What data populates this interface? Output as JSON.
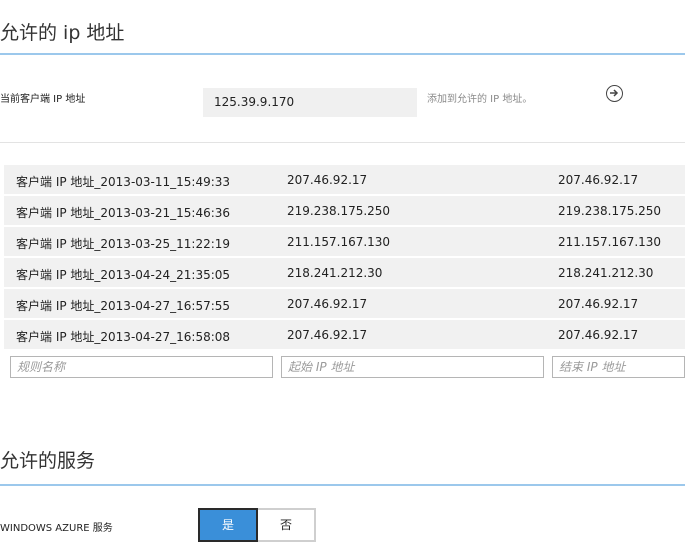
{
  "allowed_ip": {
    "title": "允许的 ip 地址",
    "current_client_label": "当前客户端 IP 地址",
    "current_client_value": "125.39.9.170",
    "add_hint": "添加到允许的 IP 地址。",
    "add_icon": "arrow-right-circle-icon"
  },
  "rules": [
    {
      "name": "客户端 IP 地址_2013-03-11_15:49:33",
      "start": "207.46.92.17",
      "end": "207.46.92.17"
    },
    {
      "name": "客户端 IP 地址_2013-03-21_15:46:36",
      "start": "219.238.175.250",
      "end": "219.238.175.250"
    },
    {
      "name": "客户端 IP 地址_2013-03-25_11:22:19",
      "start": "211.157.167.130",
      "end": "211.157.167.130"
    },
    {
      "name": "客户端 IP 地址_2013-04-24_21:35:05",
      "start": "218.241.212.30",
      "end": "218.241.212.30"
    },
    {
      "name": "客户端 IP 地址_2013-04-27_16:57:55",
      "start": "207.46.92.17",
      "end": "207.46.92.17"
    },
    {
      "name": "客户端 IP 地址_2013-04-27_16:58:08",
      "start": "207.46.92.17",
      "end": "207.46.92.17"
    }
  ],
  "new_rule": {
    "name_placeholder": "规则名称",
    "start_placeholder": "起始 IP 地址",
    "end_placeholder": "结束 IP 地址"
  },
  "services": {
    "title": "允许的服务",
    "azure_label": "WINDOWS AZURE 服务",
    "yes_label": "是",
    "no_label": "否",
    "selected": "是",
    "accent_color": "#3a8fd9"
  }
}
